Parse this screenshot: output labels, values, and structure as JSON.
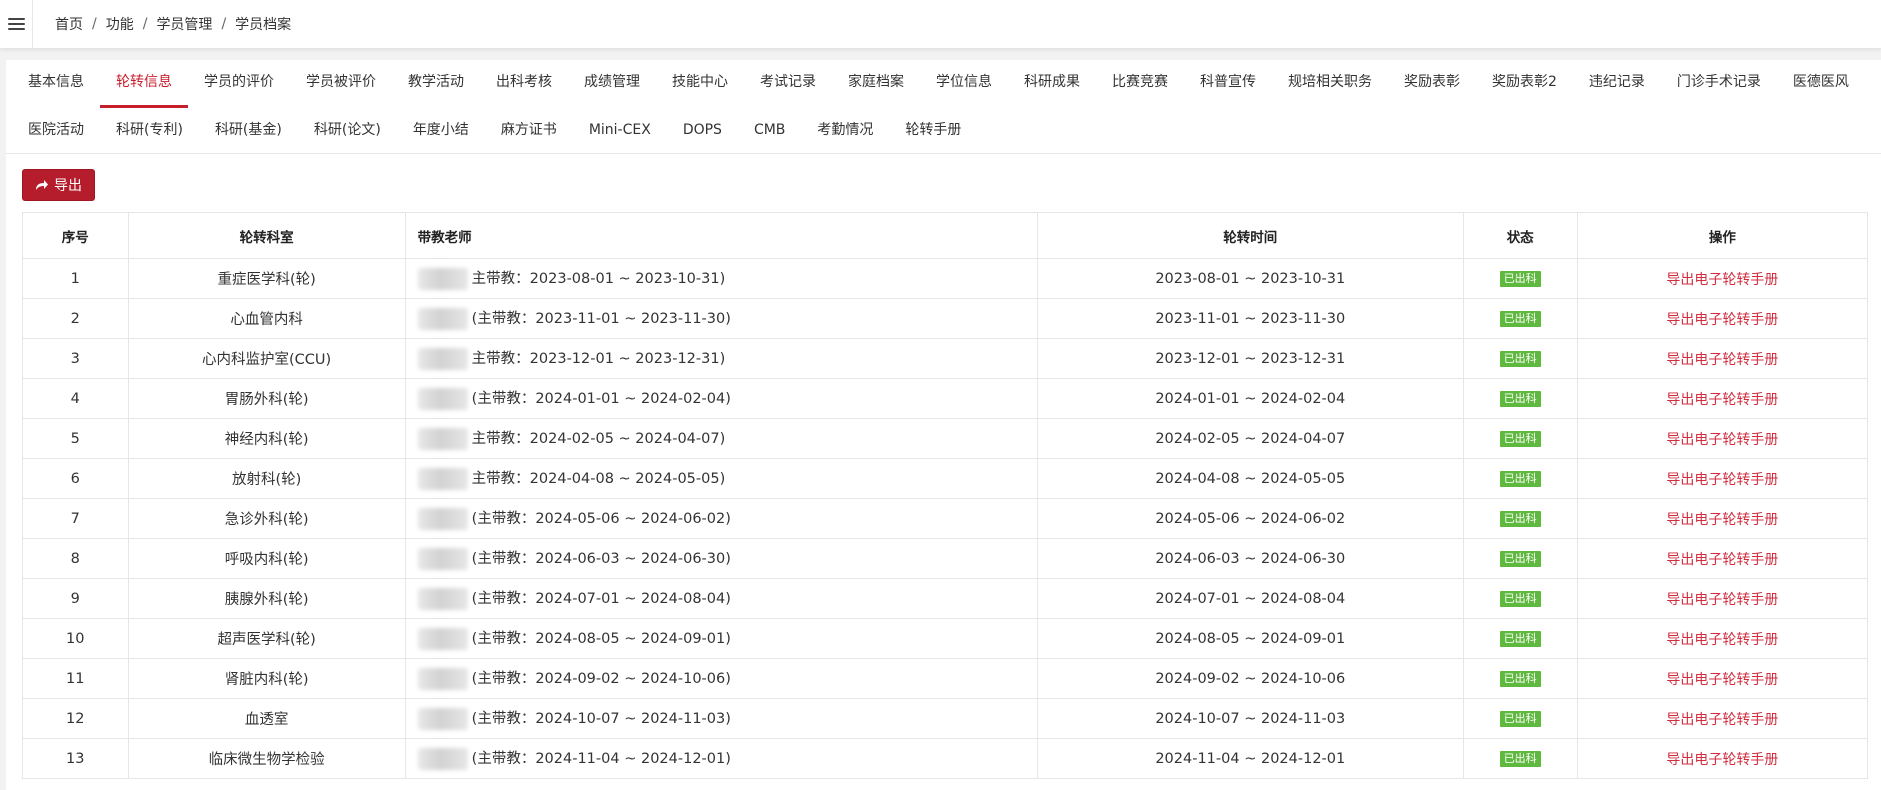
{
  "breadcrumb": [
    "首页",
    "功能",
    "学员管理",
    "学员档案"
  ],
  "tabs_row1": [
    "基本信息",
    "轮转信息",
    "学员的评价",
    "学员被评价",
    "教学活动",
    "出科考核",
    "成绩管理",
    "技能中心",
    "考试记录",
    "家庭档案",
    "学位信息",
    "科研成果",
    "比赛竞赛",
    "科普宣传",
    "规培相关职务",
    "奖励表彰",
    "奖励表彰2",
    "违纪记录",
    "门诊手术记录",
    "医德医风"
  ],
  "tabs_row2": [
    "医院活动",
    "科研(专利)",
    "科研(基金)",
    "科研(论文)",
    "年度小结",
    "麻方证书",
    "Mini-CEX",
    "DOPS",
    "CMB",
    "考勤情况",
    "轮转手册"
  ],
  "active_tab": "轮转信息",
  "export_label": "导出",
  "table": {
    "headers": {
      "index": "序号",
      "dept": "轮转科室",
      "teacher": "带教老师",
      "period": "轮转时间",
      "status": "状态",
      "action": "操作"
    },
    "rows": [
      {
        "index": "1",
        "dept": "重症医学科(轮)",
        "teacher": "主带教：2023-08-01 ~ 2023-10-31)",
        "period": "2023-08-01 ~ 2023-10-31",
        "status": "已出科",
        "action": "导出电子轮转手册"
      },
      {
        "index": "2",
        "dept": "心血管内科",
        "teacher": "(主带教：2023-11-01 ~ 2023-11-30)",
        "period": "2023-11-01 ~ 2023-11-30",
        "status": "已出科",
        "action": "导出电子轮转手册"
      },
      {
        "index": "3",
        "dept": "心内科监护室(CCU)",
        "teacher": "主带教：2023-12-01 ~ 2023-12-31)",
        "period": "2023-12-01 ~ 2023-12-31",
        "status": "已出科",
        "action": "导出电子轮转手册"
      },
      {
        "index": "4",
        "dept": "胃肠外科(轮)",
        "teacher": "(主带教：2024-01-01 ~ 2024-02-04)",
        "period": "2024-01-01 ~ 2024-02-04",
        "status": "已出科",
        "action": "导出电子轮转手册"
      },
      {
        "index": "5",
        "dept": "神经内科(轮)",
        "teacher": "主带教：2024-02-05 ~ 2024-04-07)",
        "period": "2024-02-05 ~ 2024-04-07",
        "status": "已出科",
        "action": "导出电子轮转手册"
      },
      {
        "index": "6",
        "dept": "放射科(轮)",
        "teacher": "主带教：2024-04-08 ~ 2024-05-05)",
        "period": "2024-04-08 ~ 2024-05-05",
        "status": "已出科",
        "action": "导出电子轮转手册"
      },
      {
        "index": "7",
        "dept": "急诊外科(轮)",
        "teacher": "(主带教：2024-05-06 ~ 2024-06-02)",
        "period": "2024-05-06 ~ 2024-06-02",
        "status": "已出科",
        "action": "导出电子轮转手册"
      },
      {
        "index": "8",
        "dept": "呼吸内科(轮)",
        "teacher": "(主带教：2024-06-03 ~ 2024-06-30)",
        "period": "2024-06-03 ~ 2024-06-30",
        "status": "已出科",
        "action": "导出电子轮转手册"
      },
      {
        "index": "9",
        "dept": "胰腺外科(轮)",
        "teacher": "(主带教：2024-07-01 ~ 2024-08-04)",
        "period": "2024-07-01 ~ 2024-08-04",
        "status": "已出科",
        "action": "导出电子轮转手册"
      },
      {
        "index": "10",
        "dept": "超声医学科(轮)",
        "teacher": "(主带教：2024-08-05 ~ 2024-09-01)",
        "period": "2024-08-05 ~ 2024-09-01",
        "status": "已出科",
        "action": "导出电子轮转手册"
      },
      {
        "index": "11",
        "dept": "肾脏内科(轮)",
        "teacher": "(主带教：2024-09-02 ~ 2024-10-06)",
        "period": "2024-09-02 ~ 2024-10-06",
        "status": "已出科",
        "action": "导出电子轮转手册"
      },
      {
        "index": "12",
        "dept": "血透室",
        "teacher": "(主带教：2024-10-07 ~ 2024-11-03)",
        "period": "2024-10-07 ~ 2024-11-03",
        "status": "已出科",
        "action": "导出电子轮转手册"
      },
      {
        "index": "13",
        "dept": "临床微生物学检验",
        "teacher": "(主带教：2024-11-04 ~ 2024-12-01)",
        "period": "2024-11-04 ~ 2024-12-01",
        "status": "已出科",
        "action": "导出电子轮转手册"
      }
    ]
  },
  "colors": {
    "accent": "#c71e2b",
    "button": "#b61d2c",
    "badge": "#5fb83f",
    "link": "#d12d3f"
  }
}
